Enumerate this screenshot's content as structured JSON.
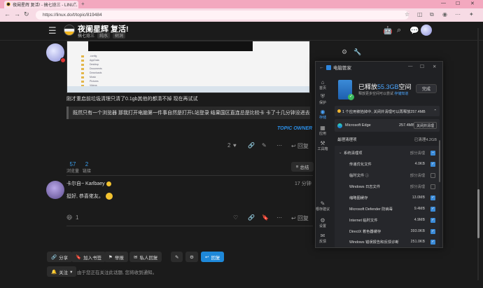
{
  "browser": {
    "tab_title": "夜阑星辉 复活! - 搞七捻三 - LINU...",
    "tab_close": "×",
    "new_tab": "+",
    "window_controls": [
      "—",
      "☐",
      "✕"
    ],
    "url": "https://linux.do/t/topic/819484",
    "nav_icons": [
      "back-icon",
      "forward-icon",
      "reload-icon"
    ]
  },
  "site": {
    "title": "夜阑星辉 复活!",
    "category": "搞七捻三",
    "tags": [
      "纯水",
      "树洞"
    ],
    "header_icons": [
      "robot-icon",
      "search-icon",
      "chat-icon",
      "avatar"
    ]
  },
  "post": {
    "line1": "刚才重启前垃圾清理只清了0.1gb其他的都清不掉 现在再试试",
    "quote": "既然只有一个浏览器 那我打开电脑第一件事自然是打开L站登录 结果国区直连总是比较卡 卡了十几分钟没进去",
    "topic_owner": "TOPIC OWNER",
    "likes": "2",
    "reply_label": "回复",
    "views": "57",
    "views_label": "浏览量",
    "links": "2",
    "links_label": "链接",
    "summary_label": "总结"
  },
  "reply": {
    "user": "卡尔自~ Karlbaey",
    "time": "17 分钟",
    "text": "挺好, 恭喜佬友。",
    "count": "1",
    "reply_label": "回复"
  },
  "footer": {
    "share": "分享",
    "bookmark": "加入书签",
    "flag": "举报",
    "invite": "私人回复",
    "edit": "",
    "admin": "",
    "reply": "回复",
    "follow": "关注",
    "follow_note": "由于您正在关注此话题, 您将收到通知。"
  },
  "pcm": {
    "title": "电脑管家",
    "win_controls": [
      "—",
      "☐",
      "✕"
    ],
    "sidebar": [
      "首页",
      "保护",
      "存储",
      "应用",
      "工具箱",
      "根存建议",
      "设置",
      "反馈"
    ],
    "hero_title_pre": "已释放",
    "hero_title_hl": "55.3GB",
    "hero_title_post": "空间",
    "hero_desc": "释放更多空间可以尝试",
    "hero_link": "存储知道",
    "hero_button": "完成",
    "notice": "1 个应用被掐掉中, 关闭并清理可以再释放257.4MB",
    "edge_name": "Microsoft Edge",
    "edge_size": "257.4MB",
    "edge_button": "关闭并清理",
    "deep_label": "最理清理项",
    "deep_status": "已清理4.2GB",
    "group": "系统清理项",
    "group_status": "部分清理",
    "items": [
      {
        "name": "传递优化文件",
        "size": "4.0KB",
        "state": "on"
      },
      {
        "name": "临时文件 ⓘ",
        "size": "部分清理",
        "state": "part"
      },
      {
        "name": "Windows 日志文件",
        "size": "部分清理",
        "state": "part"
      },
      {
        "name": "缩略图缓存",
        "size": "13.0MB",
        "state": "on"
      },
      {
        "name": "Microsoft Defender 防病毒",
        "size": "9.4MB",
        "state": "on"
      },
      {
        "name": "Internet 临时文件",
        "size": "4.9MB",
        "state": "on"
      },
      {
        "name": "DirectX 着色器缓存",
        "size": "393.0KB",
        "state": "on"
      },
      {
        "name": "Windows 错误报告和反馈诊断",
        "size": "251.0KB",
        "state": "on"
      }
    ]
  }
}
